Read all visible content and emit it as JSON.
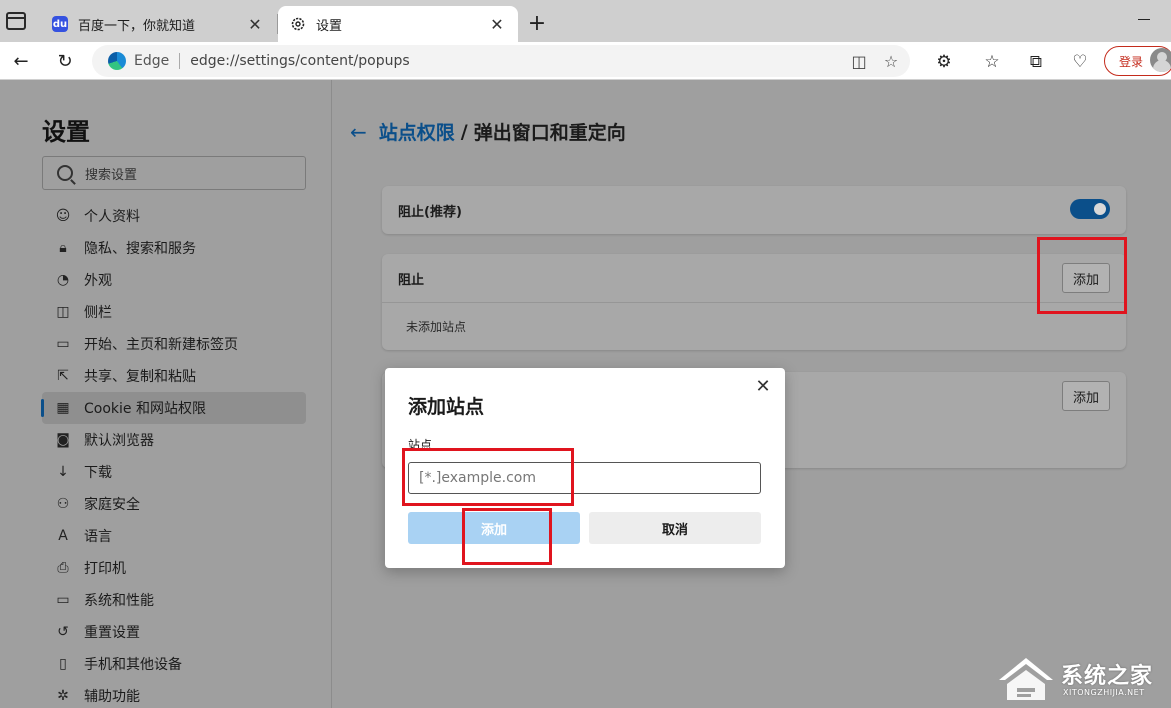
{
  "tabs": [
    {
      "title": "百度一下，你就知道",
      "favicon": "baidu-icon"
    },
    {
      "title": "设置",
      "favicon": "gear-icon"
    }
  ],
  "address": {
    "brand": "Edge",
    "url": "edge://settings/content/popups"
  },
  "login_label": "登录",
  "sidebar": {
    "title": "设置",
    "search_placeholder": "搜索设置",
    "items": [
      {
        "label": "个人资料",
        "icon": "profile-icon"
      },
      {
        "label": "隐私、搜索和服务",
        "icon": "lock-icon"
      },
      {
        "label": "外观",
        "icon": "palette-icon"
      },
      {
        "label": "侧栏",
        "icon": "sidebar-icon"
      },
      {
        "label": "开始、主页和新建标签页",
        "icon": "home-icon"
      },
      {
        "label": "共享、复制和粘贴",
        "icon": "share-icon"
      },
      {
        "label": "Cookie 和网站权限",
        "icon": "cookie-icon"
      },
      {
        "label": "默认浏览器",
        "icon": "browser-icon"
      },
      {
        "label": "下载",
        "icon": "download-icon"
      },
      {
        "label": "家庭安全",
        "icon": "family-icon"
      },
      {
        "label": "语言",
        "icon": "language-icon"
      },
      {
        "label": "打印机",
        "icon": "printer-icon"
      },
      {
        "label": "系统和性能",
        "icon": "laptop-icon"
      },
      {
        "label": "重置设置",
        "icon": "reset-icon"
      },
      {
        "label": "手机和其他设备",
        "icon": "phone-icon"
      },
      {
        "label": "辅助功能",
        "icon": "accessibility-icon"
      }
    ],
    "selected_index": 6
  },
  "main": {
    "breadcrumb_link": "站点权限",
    "breadcrumb_sep": "/",
    "breadcrumb_current": "弹出窗口和重定向",
    "block_recommended_label": "阻止(推荐)",
    "block_recommended_on": true,
    "block_section_title": "阻止",
    "block_empty_text": "未添加站点",
    "add_label": "添加"
  },
  "dialog": {
    "title": "添加站点",
    "field_label": "站点",
    "input_placeholder": "[*.]example.com",
    "add_label": "添加",
    "cancel_label": "取消"
  },
  "watermark": {
    "text": "系统之家",
    "sub": "XITONGZHIJIA.NET"
  },
  "colors": {
    "accent": "#0b4f8a",
    "highlight": "#e0141e",
    "login": "#c42b1c"
  }
}
